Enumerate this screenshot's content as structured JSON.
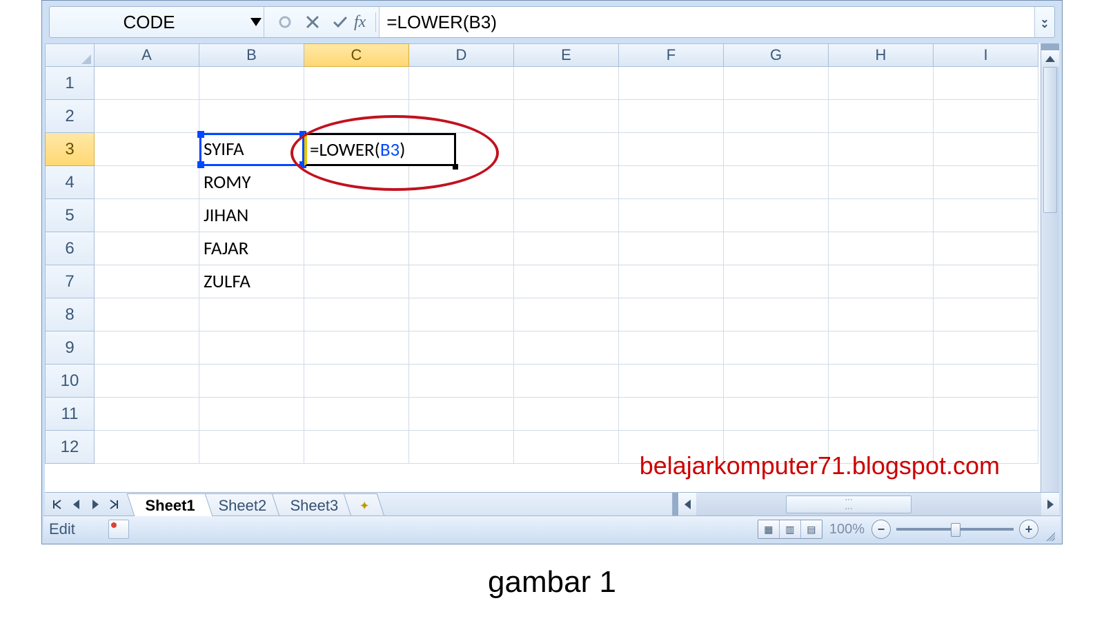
{
  "formula_bar": {
    "name_box": "CODE",
    "fx_label": "fx",
    "formula_text": "=LOWER(B3)"
  },
  "columns": [
    "A",
    "B",
    "C",
    "D",
    "E",
    "F",
    "G",
    "H",
    "I"
  ],
  "selected_column": "C",
  "row_count": 12,
  "selected_row": 3,
  "cells": {
    "B3": "SYIFA",
    "B4": "ROMY",
    "B5": "JIHAN",
    "B6": "FAJAR",
    "B7": "ZULFA"
  },
  "editing_cell": {
    "ref": "C3",
    "prefix": "=LOWER(",
    "arg": "B3",
    "suffix": ")"
  },
  "sheets": {
    "tabs": [
      "Sheet1",
      "Sheet2",
      "Sheet3"
    ],
    "active": "Sheet1",
    "new_tab_glyph": "✦"
  },
  "status_bar": {
    "mode": "Edit",
    "zoom_pct": "100%"
  },
  "watermark": "belajarkomputer71.blogspot.com",
  "caption": "gambar 1"
}
